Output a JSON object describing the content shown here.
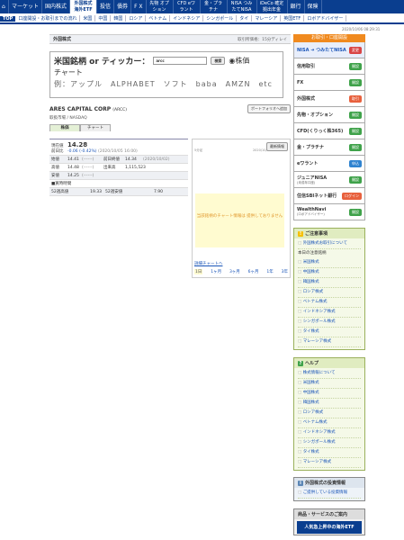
{
  "nav": [
    "マーケット",
    "国内株式",
    "外国株式 海外ETF",
    "投信",
    "債券",
    "F X",
    "先物 オプション",
    "CFD eワラント",
    "金・プラチナ",
    "NISA つみたてNISA",
    "iDeCo 確定拠出年金",
    "銀行",
    "保険"
  ],
  "subnav": [
    "TOP",
    "口座開設・お取引までの流れ",
    "米国",
    "中国",
    "韓国",
    "ロシア",
    "ベトナム",
    "インドネシア",
    "シンガポール",
    "タイ",
    "マレーシア",
    "英国ETF",
    "ロボアドバイザー"
  ],
  "timestamp": "2020/10/06 08:29:31",
  "header": {
    "title": "外国株式",
    "delay": "取引所価格：15分ディレイ"
  },
  "search": {
    "label": "米国銘柄 or ティッカー：",
    "value": "arcc",
    "button": "検索",
    "radio_stock": "株価",
    "radio_chart": "チャート",
    "example": "例：アップル　ALPHABET　ソフト　baba　AMZN　etc"
  },
  "company": {
    "name": "ARES CAPITAL CORP",
    "ticker": "(ARCC)",
    "portfolio_btn": "ポートフォリオへ追加",
    "market": "取扱市場 / NASDAQ"
  },
  "tabs": [
    "株価",
    "チャート"
  ],
  "quote": {
    "label_current": "現在値",
    "label_change": "前日比",
    "price": "14.28",
    "change": "-0.06 (-0.42%)",
    "change_time": "(2020/10/05 16:00)",
    "open_l": "始値",
    "open": "14.41",
    "open_t": "(------)",
    "prev_l": "前日終値",
    "prev": "14.34",
    "prev_d": "(2020/10/02)",
    "high_l": "高値",
    "high": "14.48",
    "high_t": "(------)",
    "vol_l": "出来高",
    "vol": "1,115,523",
    "low_l": "安値",
    "low": "14.25",
    "low_t": "(------)",
    "tanka": "■買時時間",
    "w52h_l": "52週高値",
    "w52h": "19.33",
    "w52l_l": "52週安値",
    "w52l": "7.90"
  },
  "chart": {
    "left_info": "5分足",
    "right_info": "2020/10/05 16:00 EST",
    "button": "最新情報",
    "no_data": "当該銘柄のチャート情報は 提供しておりません",
    "detail_link": "詳細チャートへ",
    "ranges": [
      "1日",
      "1ヶ月",
      "3ヶ月",
      "6ヶ月",
      "1年",
      "3年"
    ]
  },
  "sidebar": {
    "header": "お取引・口座開設",
    "items": [
      {
        "label": "NISA ➜ つみたてNISA",
        "badge": "変更",
        "color": "r"
      },
      {
        "label": "信用取引",
        "badge": "開設",
        "color": "g"
      },
      {
        "label": "FX",
        "badge": "開設",
        "color": "g"
      },
      {
        "label": "外国株式",
        "badge": "取引",
        "color": "o"
      },
      {
        "label": "先物・オプション",
        "badge": "開設",
        "color": "g"
      },
      {
        "label": "CFD(くりっく株365)",
        "badge": "開設",
        "color": "g"
      },
      {
        "label": "金・プラチナ",
        "badge": "開設",
        "color": "g"
      },
      {
        "label": "eワラント",
        "badge": "申込",
        "color": "b"
      },
      {
        "label": "ジュニアNISA",
        "sub": "(未成年口座)",
        "badge": "開設",
        "color": "g"
      },
      {
        "label": "住信SBIネット銀行",
        "badge": "ログイン",
        "color": "o"
      },
      {
        "label": "WealthNavi",
        "sub": "(ロボアドバイザー)",
        "badge": "開設",
        "color": "g"
      }
    ]
  },
  "notice": {
    "title": "ご注意事項",
    "first": "外国株式お取引について",
    "plain": "本日の注意銘柄",
    "items": [
      "米国株式",
      "中国株式",
      "韓国株式",
      "ロシア株式",
      "ベトナム株式",
      "インドネシア株式",
      "シンガポール株式",
      "タイ株式",
      "マレーシア株式"
    ]
  },
  "help": {
    "title": "ヘルプ",
    "items": [
      "株式情報について",
      "米国株式",
      "中国株式",
      "韓国株式",
      "ロシア株式",
      "ベトナム株式",
      "インドネシア株式",
      "シンガポール株式",
      "タイ株式",
      "マレーシア株式"
    ]
  },
  "invest": {
    "title": "外国株式の投資情報",
    "items": [
      "ご提供している投資情報"
    ]
  },
  "products": {
    "title": "商品・サービスのご案内",
    "banner": "人気急上昇中の海外ETF"
  }
}
